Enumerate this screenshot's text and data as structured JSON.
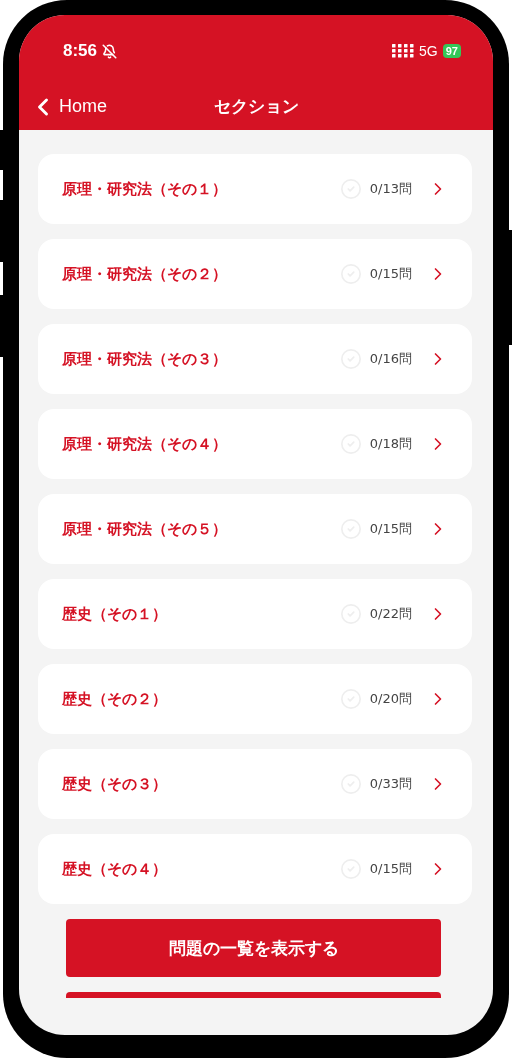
{
  "status_bar": {
    "time": "8:56",
    "network": "5G",
    "battery": "97"
  },
  "nav": {
    "back": "Home",
    "title": "セクション"
  },
  "sections": [
    {
      "title": "原理・研究法（その１）",
      "count": "0/13問",
      "completed": false
    },
    {
      "title": "原理・研究法（その２）",
      "count": "0/15問",
      "completed": false
    },
    {
      "title": "原理・研究法（その３）",
      "count": "0/16問",
      "completed": false
    },
    {
      "title": "原理・研究法（その４）",
      "count": "0/18問",
      "completed": false
    },
    {
      "title": "原理・研究法（その５）",
      "count": "0/15問",
      "completed": false
    },
    {
      "title": "歴史（その１）",
      "count": "0/22問",
      "completed": false
    },
    {
      "title": "歴史（その２）",
      "count": "0/20問",
      "completed": false
    },
    {
      "title": "歴史（その３）",
      "count": "0/33問",
      "completed": false
    },
    {
      "title": "歴史（その４）",
      "count": "0/15問",
      "completed": false
    }
  ],
  "buttons": [
    "問題の一覧を表示する"
  ]
}
